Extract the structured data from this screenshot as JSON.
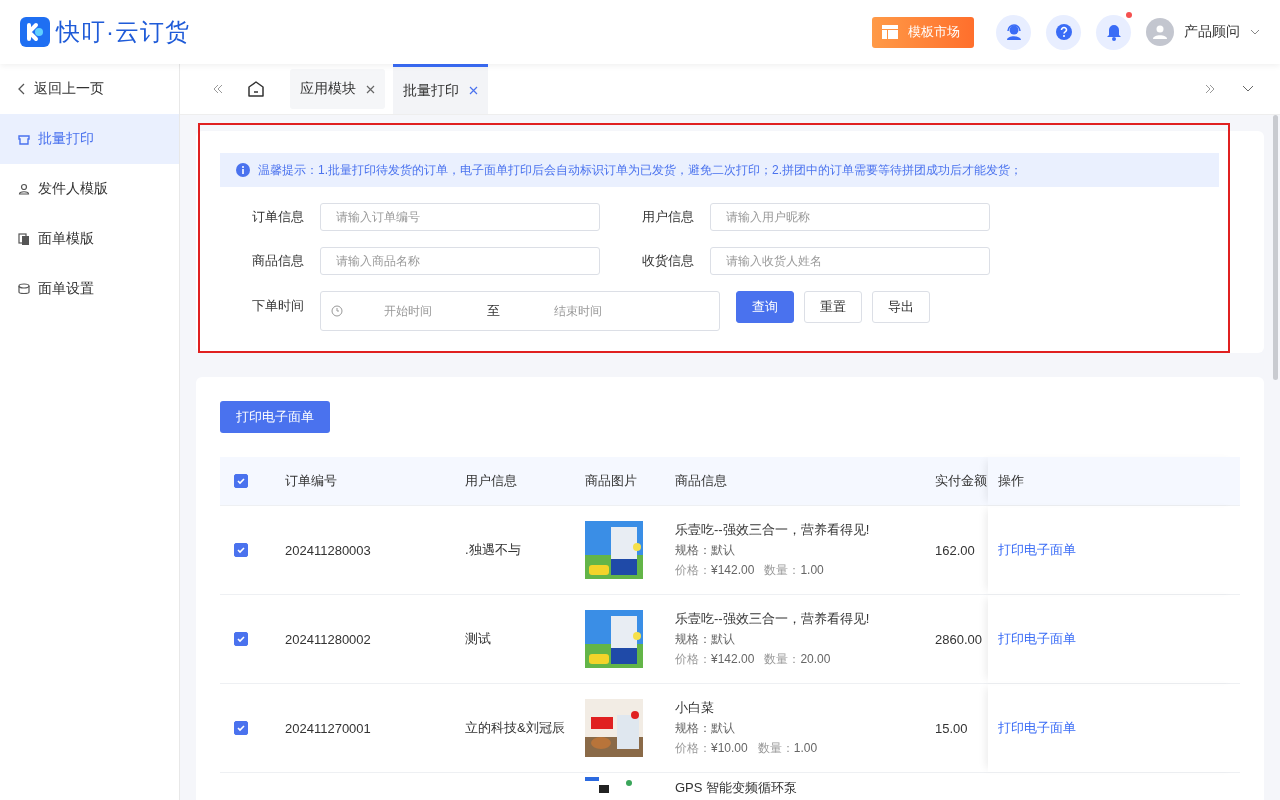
{
  "header": {
    "logo_text": "快叮·云订货",
    "market_button": "模板市场",
    "notification_dot": true,
    "user_name": "产品顾问"
  },
  "sidebar": {
    "back": "返回上一页",
    "items": [
      {
        "label": "批量打印",
        "selected": true
      },
      {
        "label": "发件人模版",
        "selected": false
      },
      {
        "label": "面单模版",
        "selected": false
      },
      {
        "label": "面单设置",
        "selected": false
      }
    ]
  },
  "tabs": [
    {
      "label": "应用模块",
      "selected": false
    },
    {
      "label": "批量打印",
      "selected": true
    }
  ],
  "filter": {
    "highlighted": true,
    "notice": "温馨提示：1.批量打印待发货的订单，电子面单打印后会自动标识订单为已发货，避免二次打印；2.拼团中的订单需要等待拼团成功后才能发货；",
    "fields": [
      {
        "label": "订单信息",
        "placeholder": "请输入订单编号"
      },
      {
        "label": "用户信息",
        "placeholder": "请输入用户昵称"
      },
      {
        "label": "商品信息",
        "placeholder": "请输入商品名称"
      },
      {
        "label": "收货信息",
        "placeholder": "请输入收货人姓名"
      }
    ],
    "date": {
      "label": "下单时间",
      "start_placeholder": "开始时间",
      "separator": "至",
      "end_placeholder": "结束时间"
    },
    "buttons": [
      {
        "label": "查询",
        "kind": "primary"
      },
      {
        "label": "重置",
        "kind": "default"
      },
      {
        "label": "导出",
        "kind": "default"
      }
    ]
  },
  "table": {
    "print_button": "打印电子面单",
    "all_checked": true,
    "columns": [
      "订单编号",
      "用户信息",
      "商品图片",
      "商品信息",
      "实付金额",
      "操作"
    ],
    "rows": [
      {
        "checked": true,
        "order_no": "202411280003",
        "user": ".独遇不与",
        "product": "乐壹吃--强效三合一，营养看得见!",
        "spec_label": "规格：",
        "spec": "默认",
        "price_label": "价格：",
        "price": "¥142.00",
        "qty_label": "数量：",
        "qty": "1.00",
        "amount": "162.00",
        "action": "打印电子面单"
      },
      {
        "checked": true,
        "order_no": "202411280002",
        "user": "测试",
        "product": "乐壹吃--强效三合一，营养看得见!",
        "spec_label": "规格：",
        "spec": "默认",
        "price_label": "价格：",
        "price": "¥142.00",
        "qty_label": "数量：",
        "qty": "20.00",
        "amount": "2860.00",
        "action": "打印电子面单"
      },
      {
        "checked": true,
        "order_no": "202411270001",
        "user": "立的科技&刘冠辰",
        "product": "小白菜",
        "spec_label": "规格：",
        "spec": "默认",
        "price_label": "价格：",
        "price": "¥10.00",
        "qty_label": "数量：",
        "qty": "1.00",
        "amount": "15.00",
        "action": "打印电子面单"
      },
      {
        "product": "GPS 智能变频循环泵"
      }
    ]
  }
}
